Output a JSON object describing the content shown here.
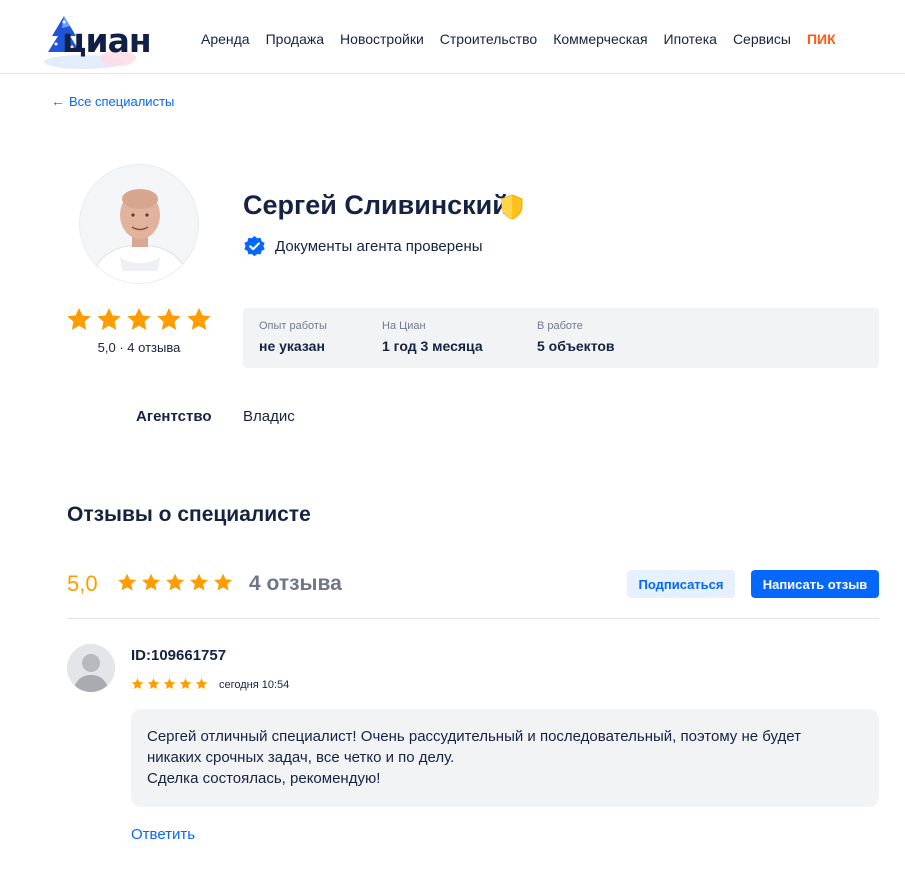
{
  "header": {
    "logo_text": "циан",
    "nav": [
      "Аренда",
      "Продажа",
      "Новостройки",
      "Строительство",
      "Коммерческая",
      "Ипотека",
      "Сервисы"
    ],
    "pik_label": "ПИК"
  },
  "back_link": "Все специалисты",
  "profile": {
    "name": "Сергей Сливинский",
    "verified_text": "Документы агента проверены",
    "rating_line": "5,0 · 4 отзыва",
    "rating_value": 5,
    "stats": [
      {
        "label": "Опыт работы",
        "value": "не указан"
      },
      {
        "label": "На Циан",
        "value": "1 год 3 месяца"
      },
      {
        "label": "В работе",
        "value": "5 объектов"
      }
    ],
    "agency_label": "Агентство",
    "agency_value": "Владис"
  },
  "reviews": {
    "title": "Отзывы о специалисте",
    "score": "5,0",
    "count": "4 отзыва",
    "subscribe_label": "Подписаться",
    "write_label": "Написать отзыв",
    "items": [
      {
        "author": "ID:109661757",
        "rating": 5,
        "date": "сегодня 10:54",
        "text": "Сергей отличный специалист! Очень рассудительный и последовательный, поэтому не будет\nникаких срочных задач, все четко и по делу.\nСделка состоялась, рекомендую!",
        "reply_label": "Ответить"
      }
    ]
  },
  "colors": {
    "accent": "#0468ff",
    "star": "#ff9d00",
    "pik": "#ff5a10",
    "text": "#152242",
    "panel": "#f2f3f5"
  }
}
